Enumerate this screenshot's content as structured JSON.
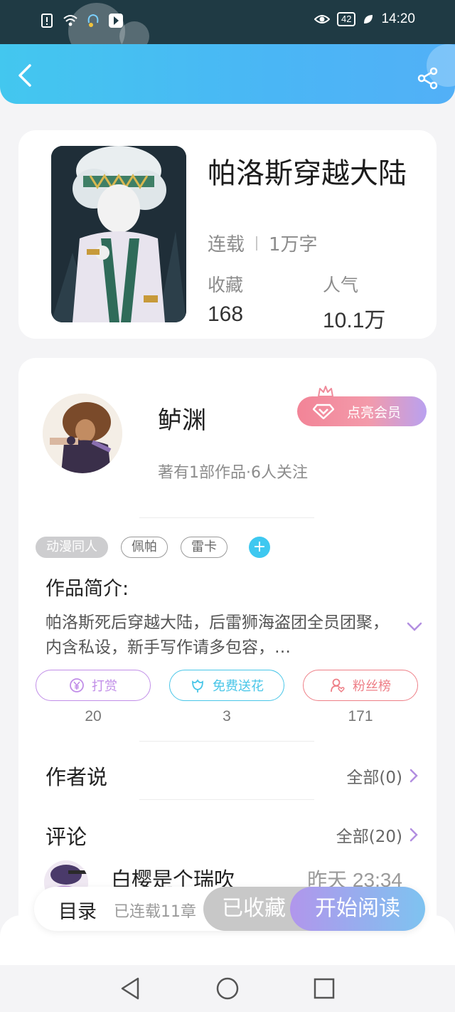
{
  "status_bar": {
    "time": "14:20",
    "battery": "42",
    "icons": [
      "alert-icon",
      "wifi-icon",
      "headset-icon",
      "app-icon",
      "eye-icon",
      "leaf-icon"
    ]
  },
  "header": {
    "back_icon": "chevron-left-icon",
    "share_icon": "share-icon",
    "background": "#45bff2"
  },
  "book": {
    "title": "帕洛斯穿越大陆",
    "status": "连载",
    "word_count": "1万字",
    "stats": [
      {
        "label": "收藏",
        "value": "168"
      },
      {
        "label": "人气",
        "value": "10.1万"
      }
    ]
  },
  "author": {
    "name": "鲈渊",
    "subtitle": "著有1部作品·6人关注",
    "member_button": "点亮会员",
    "member_colors": [
      "#f28497",
      "#b9a1f0"
    ]
  },
  "tags": [
    {
      "label": "动漫同人",
      "style": "filled"
    },
    {
      "label": "佩帕",
      "style": "outline"
    },
    {
      "label": "雷卡",
      "style": "outline"
    }
  ],
  "intro": {
    "heading": "作品简介:",
    "text": "帕洛斯死后穿越大陆，后雷狮海盗团全员团聚，内含私设，新手写作请多包容，…"
  },
  "actions": [
    {
      "label": "打赏",
      "count": "20",
      "color": "#c18ee8",
      "icon": "yuan-icon"
    },
    {
      "label": "免费送花",
      "count": "3",
      "color": "#49c6e8",
      "icon": "flower-icon"
    },
    {
      "label": "粉丝榜",
      "count": "171",
      "color": "#ee7f87",
      "icon": "fan-icon"
    }
  ],
  "author_says": {
    "title": "作者说",
    "link": "全部(0)"
  },
  "comments": {
    "title": "评论",
    "link": "全部(20)",
    "first": {
      "user": "白樱是个瑞吹",
      "time": "昨天 23:34"
    }
  },
  "bottom_bar": {
    "toc": "目录",
    "toc_status": "已连载11章",
    "favorited": "已收藏",
    "start_reading": "开始阅读"
  }
}
